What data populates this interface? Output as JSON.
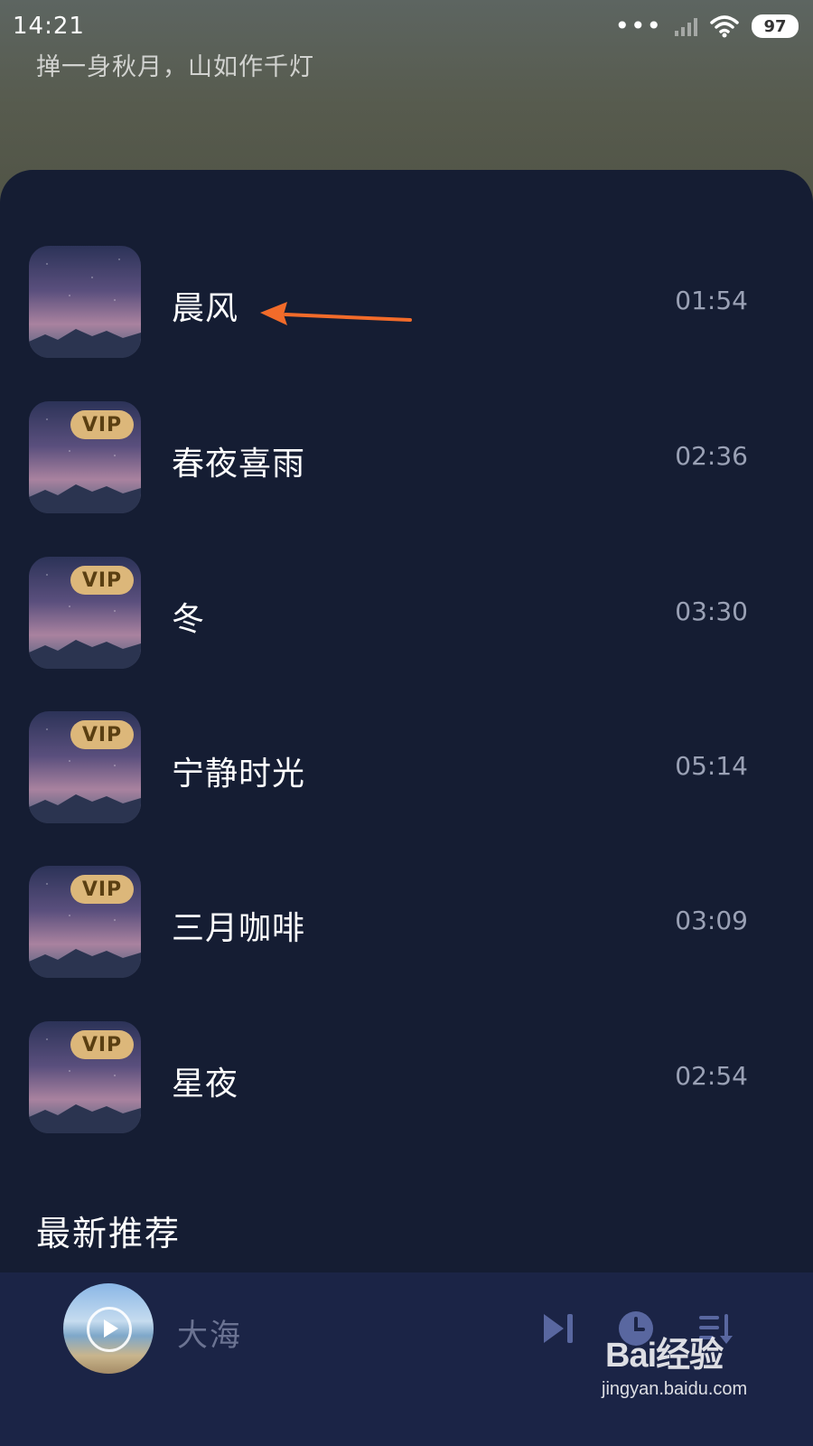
{
  "status_bar": {
    "time": "14:21",
    "battery": "97"
  },
  "header": {
    "subtitle": "掸一身秋月，山如作千灯"
  },
  "tracks": [
    {
      "title": "晨风",
      "duration": "01:54",
      "vip": false
    },
    {
      "title": "春夜喜雨",
      "duration": "02:36",
      "vip": true
    },
    {
      "title": "冬",
      "duration": "03:30",
      "vip": true
    },
    {
      "title": "宁静时光",
      "duration": "05:14",
      "vip": true
    },
    {
      "title": "三月咖啡",
      "duration": "03:09",
      "vip": true
    },
    {
      "title": "星夜",
      "duration": "02:54",
      "vip": true
    }
  ],
  "vip_label": "VIP",
  "section": {
    "title": "最新推荐"
  },
  "player": {
    "title": "大海"
  },
  "watermark": {
    "brand": "Bai经验",
    "url": "jingyan.baidu.com"
  },
  "colors": {
    "annotation_arrow": "#f26b2a",
    "vip_badge": "#dcb77a",
    "background": "#151d33"
  },
  "icons": [
    "wifi-icon",
    "signal-icon",
    "battery-icon",
    "play-icon",
    "next-track-icon",
    "timer-icon",
    "playlist-icon",
    "annotation-arrow"
  ]
}
